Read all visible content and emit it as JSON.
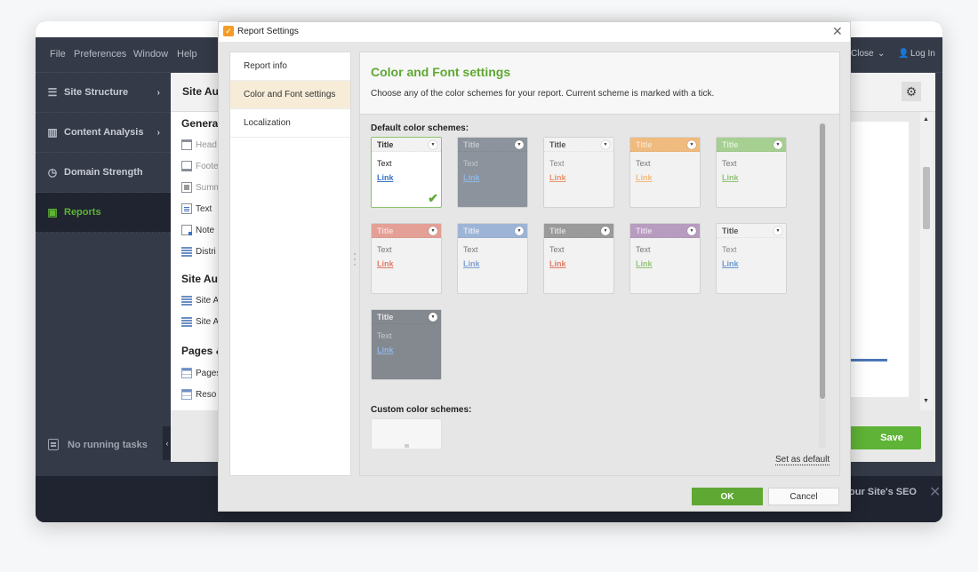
{
  "app": {
    "menu": [
      {
        "label": "File",
        "accel": "F"
      },
      {
        "label": "Preferences",
        "accel": "P"
      },
      {
        "label": "Window",
        "accel": "W"
      },
      {
        "label": "Help",
        "accel": "H"
      }
    ],
    "menubar_right": {
      "close_label": "Close",
      "login_label": "Log In"
    },
    "sidebar": {
      "items": [
        {
          "label": "Site Structure",
          "icon": "site-structure-icon",
          "has_chevron": true
        },
        {
          "label": "Content Analysis",
          "icon": "content-analysis-icon",
          "has_chevron": true
        },
        {
          "label": "Domain Strength",
          "icon": "domain-strength-icon",
          "has_chevron": false
        },
        {
          "label": "Reports",
          "icon": "reports-icon",
          "has_chevron": false,
          "active": true
        }
      ],
      "tasks_label": "No running tasks",
      "collapse_glyph": "‹"
    },
    "content": {
      "title": "Site Au",
      "sections": [
        {
          "heading": "Genera",
          "items": [
            {
              "label": "Head",
              "icon": "header-icon",
              "dim": true
            },
            {
              "label": "Foote",
              "icon": "footer-icon",
              "dim": true
            },
            {
              "label": "Summ",
              "icon": "summary-icon",
              "dim": true
            },
            {
              "label": "Text",
              "icon": "text-icon",
              "dim": false
            },
            {
              "label": "Note",
              "icon": "note-icon",
              "dim": false
            },
            {
              "label": "Distri",
              "icon": "list-icon",
              "dim": false
            }
          ]
        },
        {
          "heading": "Site Au",
          "items": [
            {
              "label": "Site A",
              "icon": "list-icon"
            },
            {
              "label": "Site A",
              "icon": "list-icon"
            }
          ]
        },
        {
          "heading": "Pages &",
          "items": [
            {
              "label": "Pages",
              "icon": "table-icon"
            },
            {
              "label": "Reso",
              "icon": "table-icon"
            }
          ]
        }
      ],
      "save_label": "Save"
    },
    "bottom_bar": {
      "text": "our Site's SEO",
      "close_glyph": "✕"
    }
  },
  "dialog": {
    "title": "Report Settings",
    "close_glyph": "✕",
    "nav": [
      {
        "label": "Report info",
        "active": false
      },
      {
        "label": "Color and Font settings",
        "active": true
      },
      {
        "label": "Localization",
        "active": false
      }
    ],
    "panel": {
      "title": "Color and Font settings",
      "description": "Choose any of the color schemes for your report. Current scheme is marked with a tick.",
      "default_label": "Default color schemes:",
      "custom_label": "Custom color schemes:",
      "set_default_label": "Set as default"
    },
    "schemes": [
      {
        "title": "Title",
        "text": "Text",
        "link": "Link",
        "selected": true,
        "head_bg": "#f2f2f2",
        "body_bg": "#ffffff",
        "title_color": "#333333",
        "text_color": "#222222",
        "link_color": "#3b73c4"
      },
      {
        "title": "Title",
        "text": "Text",
        "link": "Link",
        "selected": false,
        "head_bg": "#8c939c",
        "body_bg": "#8c939c",
        "title_color": "#c5c9cf",
        "text_color": "#c5c9cf",
        "link_color": "#8fb8e6"
      },
      {
        "title": "Title",
        "text": "Text",
        "link": "Link",
        "selected": false,
        "head_bg": "#f2f2f2",
        "body_bg": "#f2f2f2",
        "title_color": "#555555",
        "text_color": "#888888",
        "link_color": "#e8946e"
      },
      {
        "title": "Title",
        "text": "Text",
        "link": "Link",
        "selected": false,
        "head_bg": "#f0bb7e",
        "body_bg": "#f2f2f2",
        "title_color": "#f8e2c6",
        "text_color": "#777777",
        "link_color": "#f0bb7e"
      },
      {
        "title": "Title",
        "text": "Text",
        "link": "Link",
        "selected": false,
        "head_bg": "#a6cf92",
        "body_bg": "#f2f2f2",
        "title_color": "#e0efd8",
        "text_color": "#777777",
        "link_color": "#94c47c"
      },
      {
        "title": "Title",
        "text": "Text",
        "link": "Link",
        "selected": false,
        "head_bg": "#e4a096",
        "body_bg": "#f2f2f2",
        "title_color": "#f6dbd6",
        "text_color": "#777777",
        "link_color": "#e37c64"
      },
      {
        "title": "Title",
        "text": "Text",
        "link": "Link",
        "selected": false,
        "head_bg": "#9eb4d6",
        "body_bg": "#f2f2f2",
        "title_color": "#dfe7f3",
        "text_color": "#777777",
        "link_color": "#7f9fd0"
      },
      {
        "title": "Title",
        "text": "Text",
        "link": "Link",
        "selected": false,
        "head_bg": "#9a9a9a",
        "body_bg": "#f2f2f2",
        "title_color": "#dddddd",
        "text_color": "#777777",
        "link_color": "#e37c64"
      },
      {
        "title": "Title",
        "text": "Text",
        "link": "Link",
        "selected": false,
        "head_bg": "#b89cbf",
        "body_bg": "#f2f2f2",
        "title_color": "#e8dcec",
        "text_color": "#777777",
        "link_color": "#94c47c"
      },
      {
        "title": "Title",
        "text": "Text",
        "link": "Link",
        "selected": false,
        "head_bg": "#f2f2f2",
        "body_bg": "#f2f2f2",
        "title_color": "#555555",
        "text_color": "#888888",
        "link_color": "#6a9ad0"
      },
      {
        "title": "Title",
        "text": "Text",
        "link": "Link",
        "selected": false,
        "head_bg": "#84888f",
        "body_bg": "#84888f",
        "title_color": "#e6e6e6",
        "text_color": "#c8cbd0",
        "link_color": "#8fb8e6"
      }
    ],
    "ok_label": "OK",
    "cancel_label": "Cancel"
  },
  "colors": {
    "accent_green": "#5fa833",
    "sidebar_bg": "#343a47",
    "active_nav_bg": "#f6ecd8"
  }
}
